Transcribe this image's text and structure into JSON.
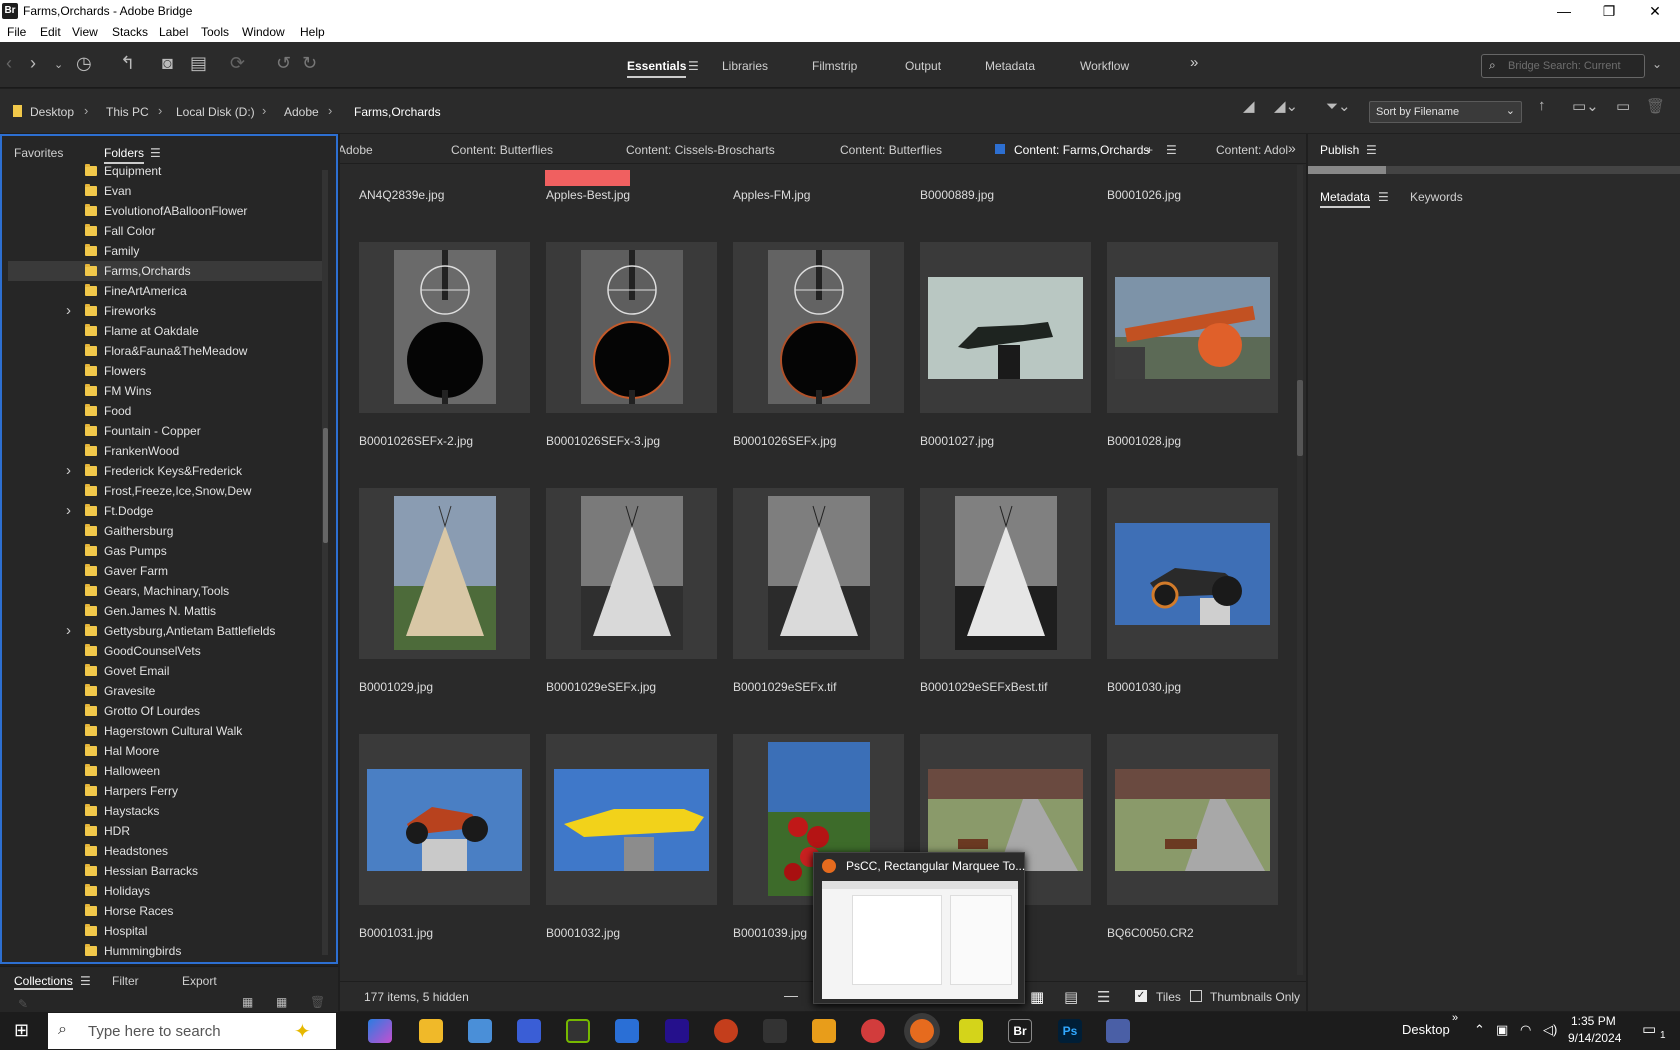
{
  "window": {
    "title": "Farms,Orchards - Adobe Bridge",
    "app_badge": "Br"
  },
  "menu": [
    "File",
    "Edit",
    "View",
    "Stacks",
    "Label",
    "Tools",
    "Window",
    "Help"
  ],
  "workspaces": [
    "Essentials",
    "Libraries",
    "Filmstrip",
    "Output",
    "Metadata",
    "Workflow"
  ],
  "search": {
    "placeholder": "Bridge Search: Current"
  },
  "breadcrumb": [
    "Desktop",
    "This PC",
    "Local Disk (D:)",
    "Adobe",
    "Farms,Orchards"
  ],
  "sort": {
    "label": "Sort by Filename"
  },
  "left_panel": {
    "tabs": [
      "Favorites",
      "Folders"
    ],
    "folders": [
      {
        "name": "Equipment"
      },
      {
        "name": "Evan"
      },
      {
        "name": "EvolutionofABalloonFlower"
      },
      {
        "name": "Fall Color"
      },
      {
        "name": "Family"
      },
      {
        "name": "Farms,Orchards",
        "selected": true
      },
      {
        "name": "FineArtAmerica"
      },
      {
        "name": "Fireworks",
        "expandable": true
      },
      {
        "name": "Flame at Oakdale"
      },
      {
        "name": "Flora&Fauna&TheMeadow"
      },
      {
        "name": "Flowers"
      },
      {
        "name": "FM Wins"
      },
      {
        "name": "Food"
      },
      {
        "name": "Fountain - Copper"
      },
      {
        "name": "FrankenWood"
      },
      {
        "name": "Frederick Keys&Frederick",
        "expandable": true
      },
      {
        "name": "Frost,Freeze,Ice,Snow,Dew"
      },
      {
        "name": "Ft.Dodge",
        "expandable": true
      },
      {
        "name": "Gaithersburg"
      },
      {
        "name": "Gas Pumps"
      },
      {
        "name": "Gaver Farm"
      },
      {
        "name": "Gears, Machinary,Tools"
      },
      {
        "name": "Gen.James N. Mattis"
      },
      {
        "name": "Gettysburg,Antietam Battlefields",
        "expandable": true
      },
      {
        "name": "GoodCounselVets"
      },
      {
        "name": "Govet Email"
      },
      {
        "name": "Gravesite"
      },
      {
        "name": "Grotto Of Lourdes"
      },
      {
        "name": "Hagerstown Cultural Walk"
      },
      {
        "name": "Hal Moore"
      },
      {
        "name": "Halloween"
      },
      {
        "name": "Harpers Ferry"
      },
      {
        "name": "Haystacks"
      },
      {
        "name": "HDR"
      },
      {
        "name": "Headstones"
      },
      {
        "name": "Hessian Barracks"
      },
      {
        "name": "Holidays"
      },
      {
        "name": "Horse Races"
      },
      {
        "name": "Hospital"
      },
      {
        "name": "Hummingbirds"
      }
    ]
  },
  "bottom_left_tabs": [
    "Collections",
    "Filter",
    "Export"
  ],
  "content": {
    "tabs": [
      "Adobe",
      "Content: Butterflies",
      "Content: Cissels-Broscharts",
      "Content: Butterflies",
      "Content: Farms,Orchards",
      "Content: Adol"
    ],
    "active_tab": "Content: Farms,Orchards",
    "top_row": [
      "AN4Q2839e.jpg",
      "Apples-Best.jpg",
      "Apples-FM.jpg",
      "B0000889.jpg",
      "B0001026.jpg"
    ],
    "rows": [
      [
        "B0001026SEFx-2.jpg",
        "B0001026SEFx-3.jpg",
        "B0001026SEFx.jpg",
        "B0001027.jpg",
        "B0001028.jpg"
      ],
      [
        "B0001029.jpg",
        "B0001029eSEFx.jpg",
        "B0001029eSEFx.tif",
        "B0001029eSEFxBest.tif",
        "B0001030.jpg"
      ],
      [
        "B0001031.jpg",
        "B0001032.jpg",
        "B0001039.jpg",
        "",
        "BQ6C0050.CR2"
      ]
    ],
    "status": "177 items, 5 hidden",
    "view_options": {
      "tiles": "Tiles",
      "thumbs_only": "Thumbnails Only"
    }
  },
  "right_panel": {
    "publish": "Publish",
    "tabs": [
      "Metadata",
      "Keywords"
    ]
  },
  "popup": {
    "title": "PsCC, Rectangular Marquee To..."
  },
  "taskbar": {
    "search_placeholder": "Type here to search",
    "desktop": "Desktop",
    "time": "1:35 PM",
    "date": "9/14/2024",
    "notif": "1"
  },
  "colors": {
    "accent": "#2d6fd1",
    "label_red": "#f06060",
    "folder": "#f1c84a"
  }
}
